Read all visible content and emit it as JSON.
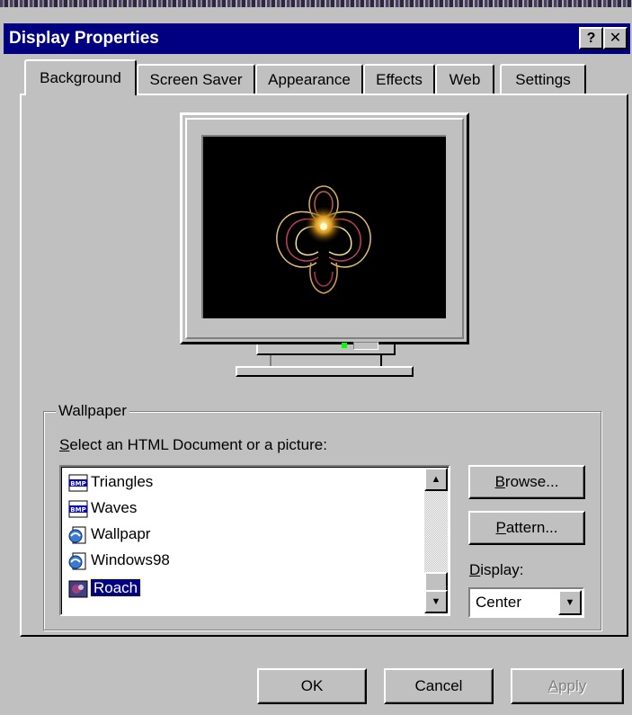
{
  "window": {
    "title": "Display Properties",
    "help_btn": "?",
    "close_btn": "✕"
  },
  "tabs": [
    {
      "label": "Background",
      "active": true
    },
    {
      "label": "Screen Saver"
    },
    {
      "label": "Appearance"
    },
    {
      "label": "Effects"
    },
    {
      "label": "Web"
    },
    {
      "label": "Settings"
    }
  ],
  "wallpaper": {
    "group_label": "Wallpaper",
    "prompt_first": "S",
    "prompt_rest": "elect an HTML Document or a picture:",
    "items": [
      {
        "label": "Triangles",
        "icon": "bmp-icon"
      },
      {
        "label": "Waves",
        "icon": "bmp-icon"
      },
      {
        "label": "Wallpapr",
        "icon": "html-document-icon"
      },
      {
        "label": "Windows98",
        "icon": "html-document-icon"
      },
      {
        "label": "Roach",
        "icon": "image-icon",
        "selected": true
      }
    ],
    "bmp_badge": "BMP"
  },
  "side": {
    "browse_first": "B",
    "browse_rest": "rowse...",
    "pattern_first": "P",
    "pattern_rest": "attern...",
    "display_first": "D",
    "display_rest": "isplay:",
    "display_value": "Center"
  },
  "footer": {
    "ok": "OK",
    "cancel": "Cancel",
    "apply_first": "A",
    "apply_rest": "pply"
  },
  "colors": {
    "title_bar": "#000080",
    "face": "#c0c0c0",
    "selection": "#000080"
  }
}
